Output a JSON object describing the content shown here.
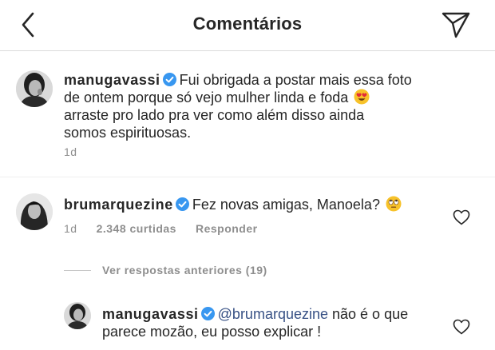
{
  "header": {
    "title": "Comentários",
    "back_icon": "chevron-left-icon",
    "share_icon": "paper-plane-icon"
  },
  "caption": {
    "username": "manugavassi",
    "verified": true,
    "text_line1": "Fui obrigada a postar mais essa foto",
    "text_line2": "de ontem porque só vejo mulher linda e foda",
    "text_line3": "arraste pro lado pra ver como além disso ainda",
    "text_line4": "somos espirituosas.",
    "emoji": "heart-eyes-emoji",
    "time": "1d"
  },
  "comments": [
    {
      "username": "brumarquezine",
      "verified": true,
      "text": "Fez novas amigas, Manoela?",
      "emoji": "rolling-eyes-emoji",
      "time": "1d",
      "likes": "2.348 curtidas",
      "reply_label": "Responder"
    }
  ],
  "view_replies": {
    "label": "Ver respostas anteriores (19)"
  },
  "reply": {
    "username": "manugavassi",
    "verified": true,
    "mention": "@brumarquezine",
    "text_line1": "não é o que",
    "text_line2": "parece mozão, eu posso explicar !"
  },
  "colors": {
    "text": "#262626",
    "secondary": "#8e8e8e",
    "verified": "#3897f0",
    "mention": "#385185",
    "divider": "#dbdbdb"
  }
}
